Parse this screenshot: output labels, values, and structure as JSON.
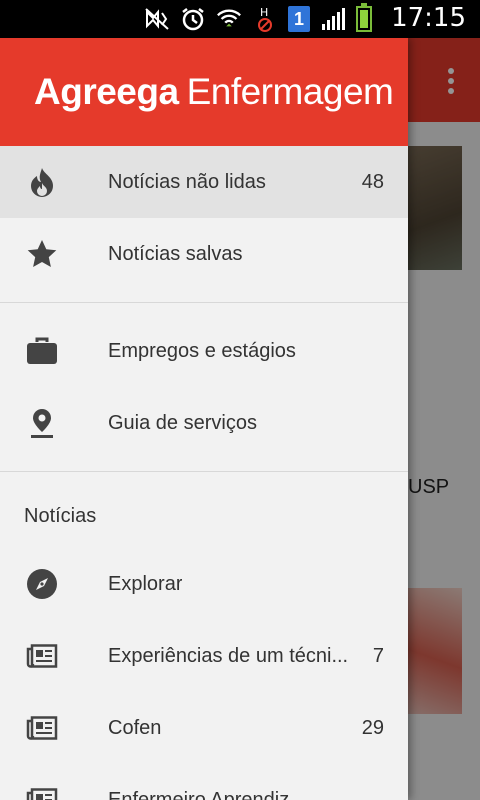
{
  "status_bar": {
    "clock": "17:15",
    "sim_slot": "1",
    "icons": [
      "mute-icon",
      "alarm-icon",
      "wifi-icon",
      "hd-icon",
      "sim-icon",
      "signal-icon",
      "battery-icon"
    ]
  },
  "background": {
    "text_fragment": "USP"
  },
  "drawer": {
    "brand": {
      "bold": "Agreega",
      "light": "Enfermagem"
    },
    "header_color": "#e53a2b",
    "primary_items": [
      {
        "label": "Notícias não lidas",
        "count": "48",
        "icon": "flame-icon",
        "selected": true
      },
      {
        "label": "Notícias salvas",
        "count": "",
        "icon": "star-icon",
        "selected": false
      }
    ],
    "secondary_items": [
      {
        "label": "Empregos e estágios",
        "icon": "briefcase-icon"
      },
      {
        "label": "Guia de serviços",
        "icon": "map-pin-icon"
      }
    ],
    "section_title": "Notícias",
    "news_items": [
      {
        "label": "Explorar",
        "count": "",
        "icon": "compass-icon"
      },
      {
        "label": "Experiências de um técni...",
        "count": "7",
        "icon": "newspaper-icon"
      },
      {
        "label": "Cofen",
        "count": "29",
        "icon": "newspaper-icon"
      },
      {
        "label": "Enfermeiro Aprendiz",
        "count": "",
        "icon": "newspaper-icon"
      }
    ]
  }
}
